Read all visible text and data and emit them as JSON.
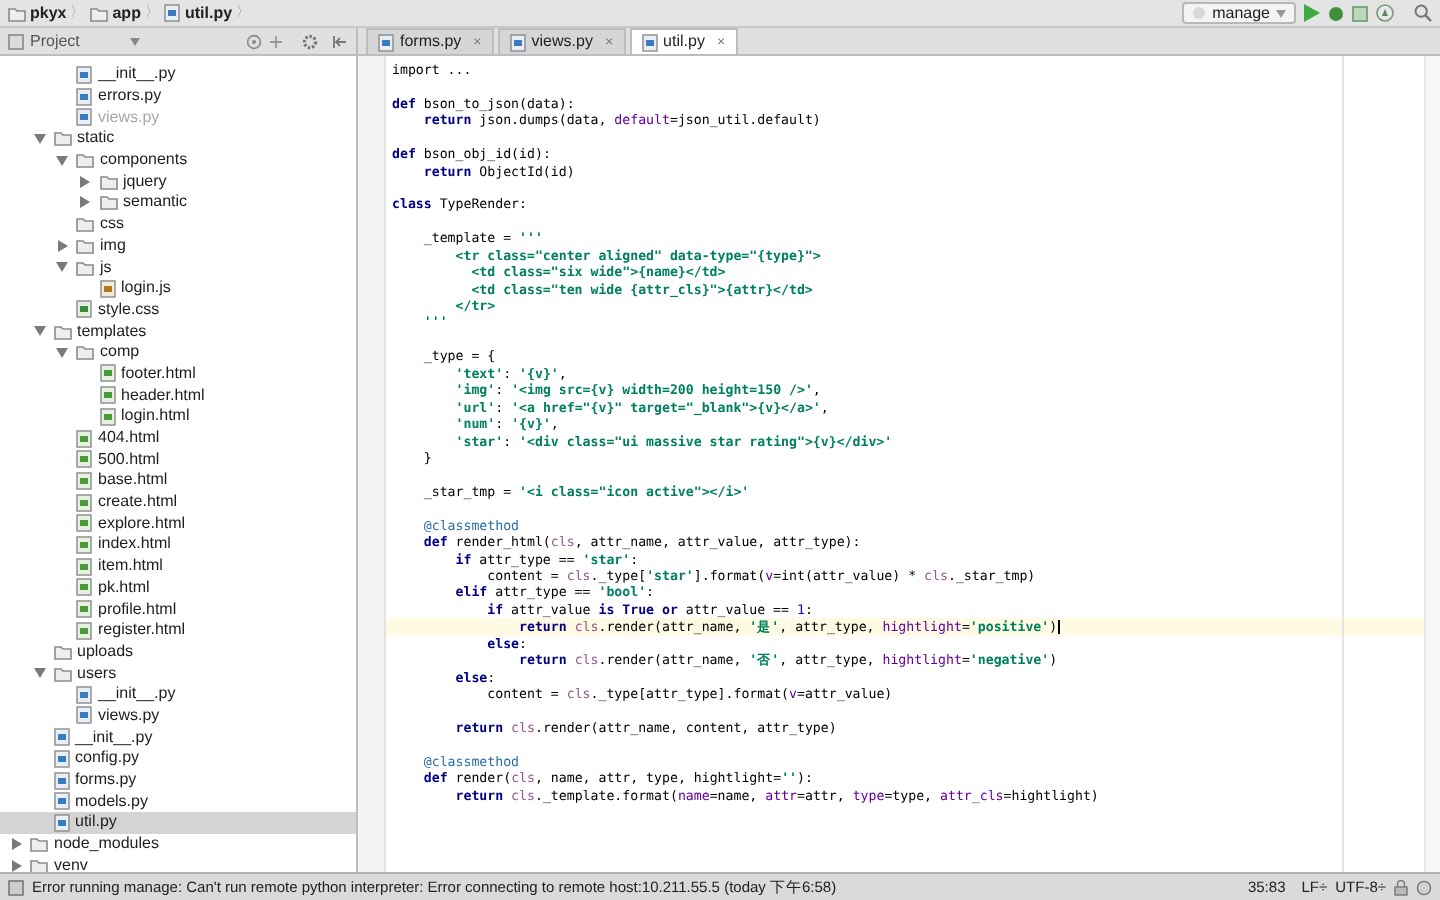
{
  "breadcrumbs": [
    {
      "kind": "folder",
      "label": "pkyx",
      "separator": "〉"
    },
    {
      "kind": "folder",
      "label": "app",
      "separator": "〉"
    },
    {
      "kind": "py",
      "label": "util.py",
      "separator": "〉"
    }
  ],
  "run_config": {
    "label": "manage"
  },
  "project_panel": {
    "title": "Project"
  },
  "tabs": [
    {
      "label": "forms.py",
      "selected": false,
      "close": "×"
    },
    {
      "label": "views.py",
      "selected": false,
      "close": "×"
    },
    {
      "label": "util.py",
      "selected": true,
      "close": "×"
    }
  ],
  "tree": {
    "items": [
      {
        "children": [
          {
            "children": [
              {
                "name": "__init__.py",
                "kind": "py",
                "muted": false,
                "selected": false
              },
              {
                "name": "errors.py",
                "kind": "py",
                "muted": false,
                "selected": false
              },
              {
                "name": "views.py",
                "kind": "py",
                "muted": true,
                "selected": false
              }
            ]
          },
          {
            "name": "static",
            "kind": "folder",
            "expanded": true,
            "muted": false,
            "selected": false,
            "children": [
              {
                "name": "components",
                "kind": "folder",
                "expanded": true,
                "muted": false,
                "selected": false,
                "children": [
                  {
                    "name": "jquery",
                    "kind": "folder",
                    "expanded": false,
                    "muted": false,
                    "selected": false
                  },
                  {
                    "name": "semantic",
                    "kind": "folder",
                    "expanded": false,
                    "muted": false,
                    "selected": false
                  }
                ]
              },
              {
                "name": "css",
                "kind": "folder",
                "muted": false,
                "selected": false
              },
              {
                "name": "img",
                "kind": "folder",
                "expanded": false,
                "muted": false,
                "selected": false
              },
              {
                "name": "js",
                "kind": "folder",
                "expanded": true,
                "muted": false,
                "selected": false,
                "children": [
                  {
                    "name": "login.js",
                    "kind": "js",
                    "muted": false,
                    "selected": false
                  }
                ]
              },
              {
                "name": "style.css",
                "kind": "css",
                "muted": false,
                "selected": false
              }
            ]
          },
          {
            "name": "templates",
            "kind": "folder",
            "expanded": true,
            "muted": false,
            "selected": false,
            "children": [
              {
                "name": "comp",
                "kind": "folder",
                "expanded": true,
                "muted": false,
                "selected": false,
                "children": [
                  {
                    "name": "footer.html",
                    "kind": "html",
                    "muted": false,
                    "selected": false
                  },
                  {
                    "name": "header.html",
                    "kind": "html",
                    "muted": false,
                    "selected": false
                  },
                  {
                    "name": "login.html",
                    "kind": "html",
                    "muted": false,
                    "selected": false
                  }
                ]
              },
              {
                "name": "404.html",
                "kind": "html",
                "muted": false,
                "selected": false
              },
              {
                "name": "500.html",
                "kind": "html",
                "muted": false,
                "selected": false
              },
              {
                "name": "base.html",
                "kind": "html",
                "muted": false,
                "selected": false
              },
              {
                "name": "create.html",
                "kind": "html",
                "muted": false,
                "selected": false
              },
              {
                "name": "explore.html",
                "kind": "html",
                "muted": false,
                "selected": false
              },
              {
                "name": "index.html",
                "kind": "html",
                "muted": false,
                "selected": false
              },
              {
                "name": "item.html",
                "kind": "html",
                "muted": false,
                "selected": false
              },
              {
                "name": "pk.html",
                "kind": "html",
                "muted": false,
                "selected": false
              },
              {
                "name": "profile.html",
                "kind": "html",
                "muted": false,
                "selected": false
              },
              {
                "name": "register.html",
                "kind": "html",
                "muted": false,
                "selected": false
              }
            ]
          },
          {
            "name": "uploads",
            "kind": "folder",
            "muted": false,
            "selected": false
          },
          {
            "name": "users",
            "kind": "folder",
            "expanded": true,
            "muted": false,
            "selected": false,
            "children": [
              {
                "name": "__init__.py",
                "kind": "py",
                "muted": false,
                "selected": false
              },
              {
                "name": "views.py",
                "kind": "py",
                "muted": false,
                "selected": false
              }
            ]
          },
          {
            "name": "__init__.py",
            "kind": "py",
            "muted": false,
            "selected": false
          },
          {
            "name": "config.py",
            "kind": "py",
            "muted": false,
            "selected": false
          },
          {
            "name": "forms.py",
            "kind": "py",
            "muted": false,
            "selected": false
          },
          {
            "name": "models.py",
            "kind": "py",
            "muted": false,
            "selected": false
          },
          {
            "name": "util.py",
            "kind": "py",
            "muted": false,
            "selected": true
          }
        ]
      },
      {
        "name": "node_modules",
        "kind": "folder",
        "expanded": false,
        "muted": false,
        "selected": false
      },
      {
        "name": "venv",
        "kind": "folder",
        "expanded": false,
        "muted": false,
        "selected": false
      }
    ]
  },
  "code": {
    "lines": [
      {
        "current": false,
        "tokens": [
          {
            "kind": "plain",
            "text": "import ..."
          }
        ]
      },
      {
        "current": false
      },
      {
        "current": false,
        "tokens": [
          {
            "kind": "keyword",
            "text": "def"
          },
          {
            "kind": "plain",
            "text": " bson_to_json(data):"
          }
        ]
      },
      {
        "current": false,
        "tokens": [
          {
            "kind": "keyword",
            "text": "    return"
          },
          {
            "kind": "plain",
            "text": " json.dumps(data, "
          },
          {
            "kind": "named_arg",
            "text": "default"
          },
          {
            "kind": "plain",
            "text": "=json_util.default)"
          }
        ]
      },
      {
        "current": false
      },
      {
        "current": false,
        "tokens": [
          {
            "kind": "keyword",
            "text": "def"
          },
          {
            "kind": "plain",
            "text": " bson_obj_id(id):"
          }
        ]
      },
      {
        "current": false,
        "tokens": [
          {
            "kind": "keyword",
            "text": "    return"
          },
          {
            "kind": "plain",
            "text": " ObjectId(id)"
          }
        ]
      },
      {
        "current": false
      },
      {
        "current": false,
        "tokens": [
          {
            "kind": "keyword",
            "text": "class"
          },
          {
            "kind": "plain",
            "text": " TypeRender:"
          }
        ]
      },
      {
        "current": false
      },
      {
        "current": false,
        "tokens": [
          {
            "kind": "plain",
            "text": "    _template = "
          },
          {
            "kind": "string",
            "text": "'''"
          }
        ]
      },
      {
        "current": false,
        "tokens": [
          {
            "kind": "string",
            "text": "        <tr class=\"center aligned\" data-type=\"{type}\">"
          }
        ]
      },
      {
        "current": false,
        "tokens": [
          {
            "kind": "string",
            "text": "          <td class=\"six wide\">{name}</td>"
          }
        ]
      },
      {
        "current": false,
        "tokens": [
          {
            "kind": "string",
            "text": "          <td class=\"ten wide {attr_cls}\">{attr}</td>"
          }
        ]
      },
      {
        "current": false,
        "tokens": [
          {
            "kind": "string",
            "text": "        </tr>"
          }
        ]
      },
      {
        "current": false,
        "tokens": [
          {
            "kind": "string",
            "text": "    '''"
          }
        ]
      },
      {
        "current": false
      },
      {
        "current": false,
        "tokens": [
          {
            "kind": "plain",
            "text": "    _type = {"
          }
        ]
      },
      {
        "current": false,
        "tokens": [
          {
            "kind": "string",
            "text": "        'text'"
          },
          {
            "kind": "plain",
            "text": ": "
          },
          {
            "kind": "string",
            "text": "'{v}'"
          },
          {
            "kind": "plain",
            "text": ","
          }
        ]
      },
      {
        "current": false,
        "tokens": [
          {
            "kind": "string",
            "text": "        'img'"
          },
          {
            "kind": "plain",
            "text": ": "
          },
          {
            "kind": "string",
            "text": "'<img src={v} width=200 height=150 />'"
          },
          {
            "kind": "plain",
            "text": ","
          }
        ]
      },
      {
        "current": false,
        "tokens": [
          {
            "kind": "string",
            "text": "        'url'"
          },
          {
            "kind": "plain",
            "text": ": "
          },
          {
            "kind": "string",
            "text": "'<a href=\"{v}\" target=\"_blank\">{v}</a>'"
          },
          {
            "kind": "plain",
            "text": ","
          }
        ]
      },
      {
        "current": false,
        "tokens": [
          {
            "kind": "string",
            "text": "        'num'"
          },
          {
            "kind": "plain",
            "text": ": "
          },
          {
            "kind": "string",
            "text": "'{v}'"
          },
          {
            "kind": "plain",
            "text": ","
          }
        ]
      },
      {
        "current": false,
        "tokens": [
          {
            "kind": "string",
            "text": "        'star'"
          },
          {
            "kind": "plain",
            "text": ": "
          },
          {
            "kind": "string",
            "text": "'<div class=\"ui massive star rating\">{v}</div>'"
          }
        ]
      },
      {
        "current": false,
        "tokens": [
          {
            "kind": "plain",
            "text": "    }"
          }
        ]
      },
      {
        "current": false
      },
      {
        "current": false,
        "tokens": [
          {
            "kind": "plain",
            "text": "    _star_tmp = "
          },
          {
            "kind": "string",
            "text": "'<i class=\"icon active\"></i>'"
          }
        ]
      },
      {
        "current": false
      },
      {
        "current": false,
        "tokens": [
          {
            "kind": "decorator",
            "text": "    @classmethod"
          }
        ]
      },
      {
        "current": false,
        "tokens": [
          {
            "kind": "keyword",
            "text": "    def"
          },
          {
            "kind": "plain",
            "text": " render_html("
          },
          {
            "kind": "self",
            "text": "cls"
          },
          {
            "kind": "plain",
            "text": ", attr_name, attr_value, attr_type):"
          }
        ]
      },
      {
        "current": false,
        "tokens": [
          {
            "kind": "keyword",
            "text": "        if"
          },
          {
            "kind": "plain",
            "text": " attr_type == "
          },
          {
            "kind": "string",
            "text": "'star'"
          },
          {
            "kind": "plain",
            "text": ":"
          }
        ]
      },
      {
        "current": false,
        "tokens": [
          {
            "kind": "plain",
            "text": "            content = "
          },
          {
            "kind": "self",
            "text": "cls"
          },
          {
            "kind": "plain",
            "text": "._type["
          },
          {
            "kind": "string",
            "text": "'star'"
          },
          {
            "kind": "plain",
            "text": "].format("
          },
          {
            "kind": "named_arg",
            "text": "v"
          },
          {
            "kind": "plain",
            "text": "=int(attr_value) * "
          },
          {
            "kind": "self",
            "text": "cls"
          },
          {
            "kind": "plain",
            "text": "._star_tmp)"
          }
        ]
      },
      {
        "current": false,
        "tokens": [
          {
            "kind": "keyword",
            "text": "        elif"
          },
          {
            "kind": "plain",
            "text": " attr_type == "
          },
          {
            "kind": "string",
            "text": "'bool'"
          },
          {
            "kind": "plain",
            "text": ":"
          }
        ]
      },
      {
        "current": false,
        "tokens": [
          {
            "kind": "keyword",
            "text": "            if"
          },
          {
            "kind": "plain",
            "text": " attr_value "
          },
          {
            "kind": "keyword",
            "text": "is True or"
          },
          {
            "kind": "plain",
            "text": " attr_value == "
          },
          {
            "kind": "number",
            "text": "1"
          },
          {
            "kind": "plain",
            "text": ":"
          }
        ]
      },
      {
        "current": true,
        "tokens": [
          {
            "kind": "keyword",
            "text": "                return"
          },
          {
            "kind": "self",
            "text": " cls"
          },
          {
            "kind": "plain",
            "text": ".render(attr_name, "
          },
          {
            "kind": "string",
            "text": "'是'"
          },
          {
            "kind": "plain",
            "text": ", attr_type, "
          },
          {
            "kind": "named_arg",
            "text": "hightlight"
          },
          {
            "kind": "plain",
            "text": "="
          },
          {
            "kind": "string",
            "text": "'positive'"
          },
          {
            "kind": "plain",
            "text": ")"
          }
        ]
      },
      {
        "current": false,
        "tokens": [
          {
            "kind": "keyword",
            "text": "            else"
          },
          {
            "kind": "plain",
            "text": ":"
          }
        ]
      },
      {
        "current": false,
        "tokens": [
          {
            "kind": "keyword",
            "text": "                return"
          },
          {
            "kind": "self",
            "text": " cls"
          },
          {
            "kind": "plain",
            "text": ".render(attr_name, "
          },
          {
            "kind": "string",
            "text": "'否'"
          },
          {
            "kind": "plain",
            "text": ", attr_type, "
          },
          {
            "kind": "named_arg",
            "text": "hightlight"
          },
          {
            "kind": "plain",
            "text": "="
          },
          {
            "kind": "string",
            "text": "'negative'"
          },
          {
            "kind": "plain",
            "text": ")"
          }
        ]
      },
      {
        "current": false,
        "tokens": [
          {
            "kind": "keyword",
            "text": "        else"
          },
          {
            "kind": "plain",
            "text": ":"
          }
        ]
      },
      {
        "current": false,
        "tokens": [
          {
            "kind": "plain",
            "text": "            content = "
          },
          {
            "kind": "self",
            "text": "cls"
          },
          {
            "kind": "plain",
            "text": "._type[attr_type].format("
          },
          {
            "kind": "named_arg",
            "text": "v"
          },
          {
            "kind": "plain",
            "text": "=attr_value)"
          }
        ]
      },
      {
        "current": false
      },
      {
        "current": false,
        "tokens": [
          {
            "kind": "keyword",
            "text": "        return"
          },
          {
            "kind": "self",
            "text": " cls"
          },
          {
            "kind": "plain",
            "text": ".render(attr_name, content, attr_type)"
          }
        ]
      },
      {
        "current": false
      },
      {
        "current": false,
        "tokens": [
          {
            "kind": "decorator",
            "text": "    @classmethod"
          }
        ]
      },
      {
        "current": false,
        "tokens": [
          {
            "kind": "keyword",
            "text": "    def"
          },
          {
            "kind": "plain",
            "text": " render("
          },
          {
            "kind": "self",
            "text": "cls"
          },
          {
            "kind": "plain",
            "text": ", name, attr, type, hightlight="
          },
          {
            "kind": "string",
            "text": "''"
          },
          {
            "kind": "plain",
            "text": "):"
          }
        ]
      },
      {
        "current": false,
        "tokens": [
          {
            "kind": "keyword",
            "text": "        return"
          },
          {
            "kind": "self",
            "text": " cls"
          },
          {
            "kind": "plain",
            "text": "._template.format("
          },
          {
            "kind": "named_arg",
            "text": "name"
          },
          {
            "kind": "plain",
            "text": "=name, "
          },
          {
            "kind": "named_arg",
            "text": "attr"
          },
          {
            "kind": "plain",
            "text": "=attr, "
          },
          {
            "kind": "named_arg",
            "text": "type"
          },
          {
            "kind": "plain",
            "text": "=type, "
          },
          {
            "kind": "named_arg",
            "text": "attr_cls"
          },
          {
            "kind": "plain",
            "text": "=hightlight)"
          }
        ]
      }
    ]
  },
  "status_bar": {
    "message": "Error running manage: Can't run remote python interpreter: Error connecting to remote host:10.211.55.5 (today 下午6:58)",
    "position": "35:83",
    "line_separator": "LF÷",
    "encoding": "UTF-8÷"
  }
}
